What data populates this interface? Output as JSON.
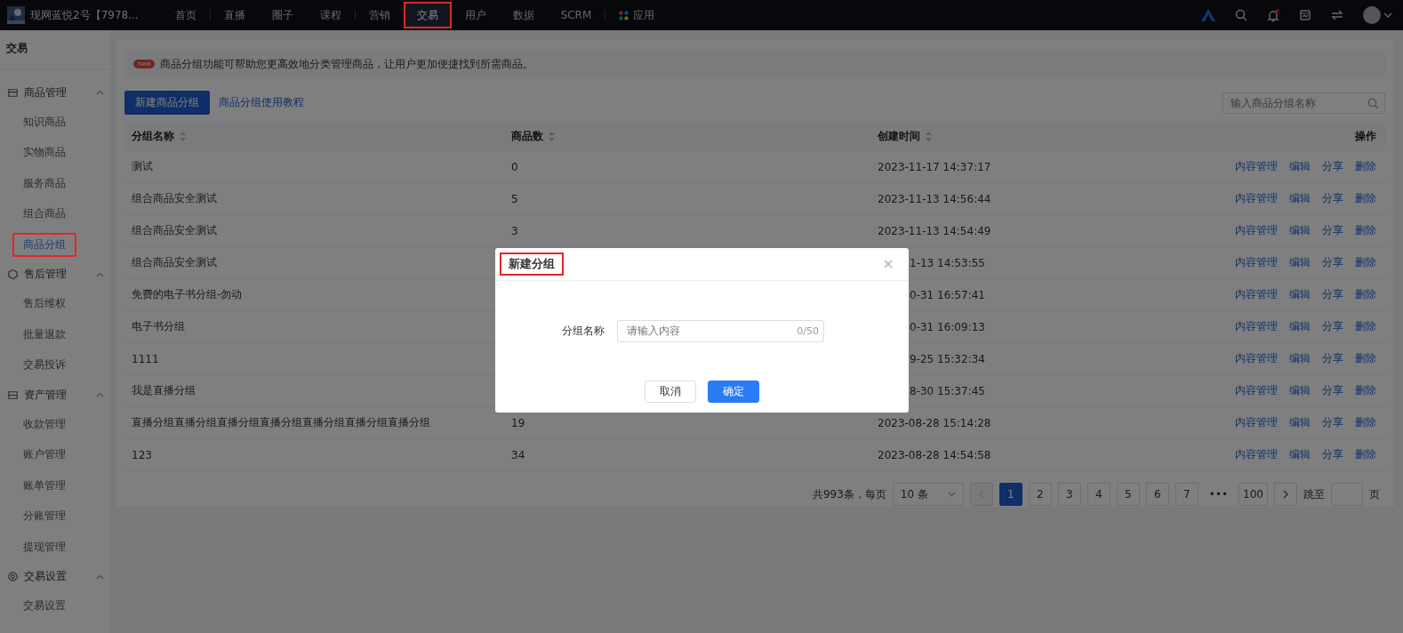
{
  "top_bar": {
    "account": "现网蓝悦2号【7978...",
    "nav": [
      {
        "label": "首页",
        "kind": "link",
        "selected": false,
        "highlighted": false,
        "divider_after": true
      },
      {
        "label": "直播",
        "kind": "link",
        "selected": false,
        "highlighted": false,
        "divider_after": false
      },
      {
        "label": "圈子",
        "kind": "link",
        "selected": false,
        "highlighted": false,
        "divider_after": false
      },
      {
        "label": "课程",
        "kind": "link",
        "selected": false,
        "highlighted": false,
        "divider_after": true
      },
      {
        "label": "营销",
        "kind": "link",
        "selected": false,
        "highlighted": false,
        "divider_after": false
      },
      {
        "label": "交易",
        "kind": "link",
        "selected": true,
        "highlighted": true,
        "divider_after": false
      },
      {
        "label": "用户",
        "kind": "link",
        "selected": false,
        "highlighted": false,
        "divider_after": false
      },
      {
        "label": "数据",
        "kind": "link",
        "selected": false,
        "highlighted": false,
        "divider_after": false
      },
      {
        "label": "SCRM",
        "kind": "link",
        "selected": false,
        "highlighted": false,
        "divider_after": true
      },
      {
        "label": "应用",
        "kind": "apps",
        "selected": false,
        "highlighted": false,
        "divider_after": false
      }
    ],
    "notification_unread": true
  },
  "sidebar": {
    "title": "交易",
    "groups": [
      {
        "label": "商品管理",
        "expanded": true,
        "children": [
          {
            "label": "知识商品",
            "selected": false,
            "highlighted": false
          },
          {
            "label": "实物商品",
            "selected": false,
            "highlighted": false
          },
          {
            "label": "服务商品",
            "selected": false,
            "highlighted": false
          },
          {
            "label": "组合商品",
            "selected": false,
            "highlighted": false
          },
          {
            "label": "商品分组",
            "selected": true,
            "highlighted": true
          }
        ]
      },
      {
        "label": "售后管理",
        "expanded": true,
        "children": [
          {
            "label": "售后维权",
            "selected": false,
            "highlighted": false
          },
          {
            "label": "批量退款",
            "selected": false,
            "highlighted": false
          },
          {
            "label": "交易投诉",
            "selected": false,
            "highlighted": false
          }
        ]
      },
      {
        "label": "资产管理",
        "expanded": true,
        "children": [
          {
            "label": "收款管理",
            "selected": false,
            "highlighted": false
          },
          {
            "label": "账户管理",
            "selected": false,
            "highlighted": false
          },
          {
            "label": "账单管理",
            "selected": false,
            "highlighted": false
          },
          {
            "label": "分账管理",
            "selected": false,
            "highlighted": false
          },
          {
            "label": "提现管理",
            "selected": false,
            "highlighted": false
          }
        ]
      },
      {
        "label": "交易设置",
        "expanded": true,
        "children": [
          {
            "label": "交易设置",
            "selected": false,
            "highlighted": false
          }
        ]
      }
    ]
  },
  "notice": {
    "badge": "new",
    "text": "商品分组功能可帮助您更高效地分类管理商品，让用户更加便捷找到所需商品。"
  },
  "toolbar": {
    "create_button": "新建商品分组",
    "tutorial_link": "商品分组使用教程",
    "search_placeholder": "输入商品分组名称"
  },
  "table": {
    "columns": [
      {
        "label": "分组名称",
        "sortable": true
      },
      {
        "label": "商品数",
        "sortable": true
      },
      {
        "label": "创建时间",
        "sortable": true
      },
      {
        "label": "操作",
        "sortable": false
      }
    ],
    "rows": [
      {
        "name": "测试",
        "count": "0",
        "created": "2023-11-17 14:37:17",
        "under_dialog": false,
        "actions": [
          "内容管理",
          "编辑",
          "分享",
          "删除"
        ]
      },
      {
        "name": "组合商品安全测试",
        "count": "5",
        "created": "2023-11-13 14:56:44",
        "under_dialog": false,
        "actions": [
          "内容管理",
          "编辑",
          "分享",
          "删除"
        ]
      },
      {
        "name": "组合商品安全测试",
        "count": "3",
        "created": "2023-11-13 14:54:49",
        "under_dialog": false,
        "actions": [
          "内容管理",
          "编辑",
          "分享",
          "删除"
        ]
      },
      {
        "name": "组合商品安全测试",
        "created": "1-13 14:53:55",
        "under_dialog": true,
        "actions": [
          "内容管理",
          "编辑",
          "分享",
          "删除"
        ]
      },
      {
        "name": "免费的电子书分组-勿动",
        "created": "0-31 16:57:41",
        "under_dialog": true,
        "actions": [
          "内容管理",
          "编辑",
          "分享",
          "删除"
        ]
      },
      {
        "name": "电子书分组",
        "created": "0-31 16:09:13",
        "under_dialog": true,
        "actions": [
          "内容管理",
          "编辑",
          "分享",
          "删除"
        ]
      },
      {
        "name": "1111",
        "created": "9-25 15:32:34",
        "under_dialog": true,
        "actions": [
          "内容管理",
          "编辑",
          "分享",
          "删除"
        ]
      },
      {
        "name": "我是直播分组",
        "created": "8-30 15:37:45",
        "under_dialog": true,
        "actions": [
          "内容管理",
          "编辑",
          "分享",
          "删除"
        ]
      },
      {
        "name": "直播分组直播分组直播分组直播分组直播分组直播分组直播分组",
        "count": "19",
        "created": "2023-08-28 15:14:28",
        "under_dialog": false,
        "actions": [
          "内容管理",
          "编辑",
          "分享",
          "删除"
        ]
      },
      {
        "name": "123",
        "count": "34",
        "created": "2023-08-28 14:54:58",
        "under_dialog": false,
        "actions": [
          "内容管理",
          "编辑",
          "分享",
          "删除"
        ]
      }
    ]
  },
  "pagination": {
    "total": "共993条，每页",
    "page_size": "10 条",
    "pages": [
      {
        "label": "1",
        "selected": true
      },
      {
        "label": "2",
        "selected": false
      },
      {
        "label": "3",
        "selected": false
      },
      {
        "label": "4",
        "selected": false
      },
      {
        "label": "5",
        "selected": false
      },
      {
        "label": "6",
        "selected": false
      },
      {
        "label": "7",
        "selected": false
      },
      {
        "label": "•••",
        "selected": false
      },
      {
        "label": "100",
        "selected": false
      }
    ],
    "prev_disabled": true,
    "jump_label": "跳至",
    "jump_suffix": "页"
  },
  "dialog": {
    "title": "新建分组",
    "highlighted": true,
    "field_label": "分组名称",
    "placeholder": "请输入内容",
    "counter": "0/50",
    "buttons": [
      {
        "label": "取消",
        "kind": "secondary"
      },
      {
        "label": "确定",
        "kind": "primary"
      }
    ]
  }
}
